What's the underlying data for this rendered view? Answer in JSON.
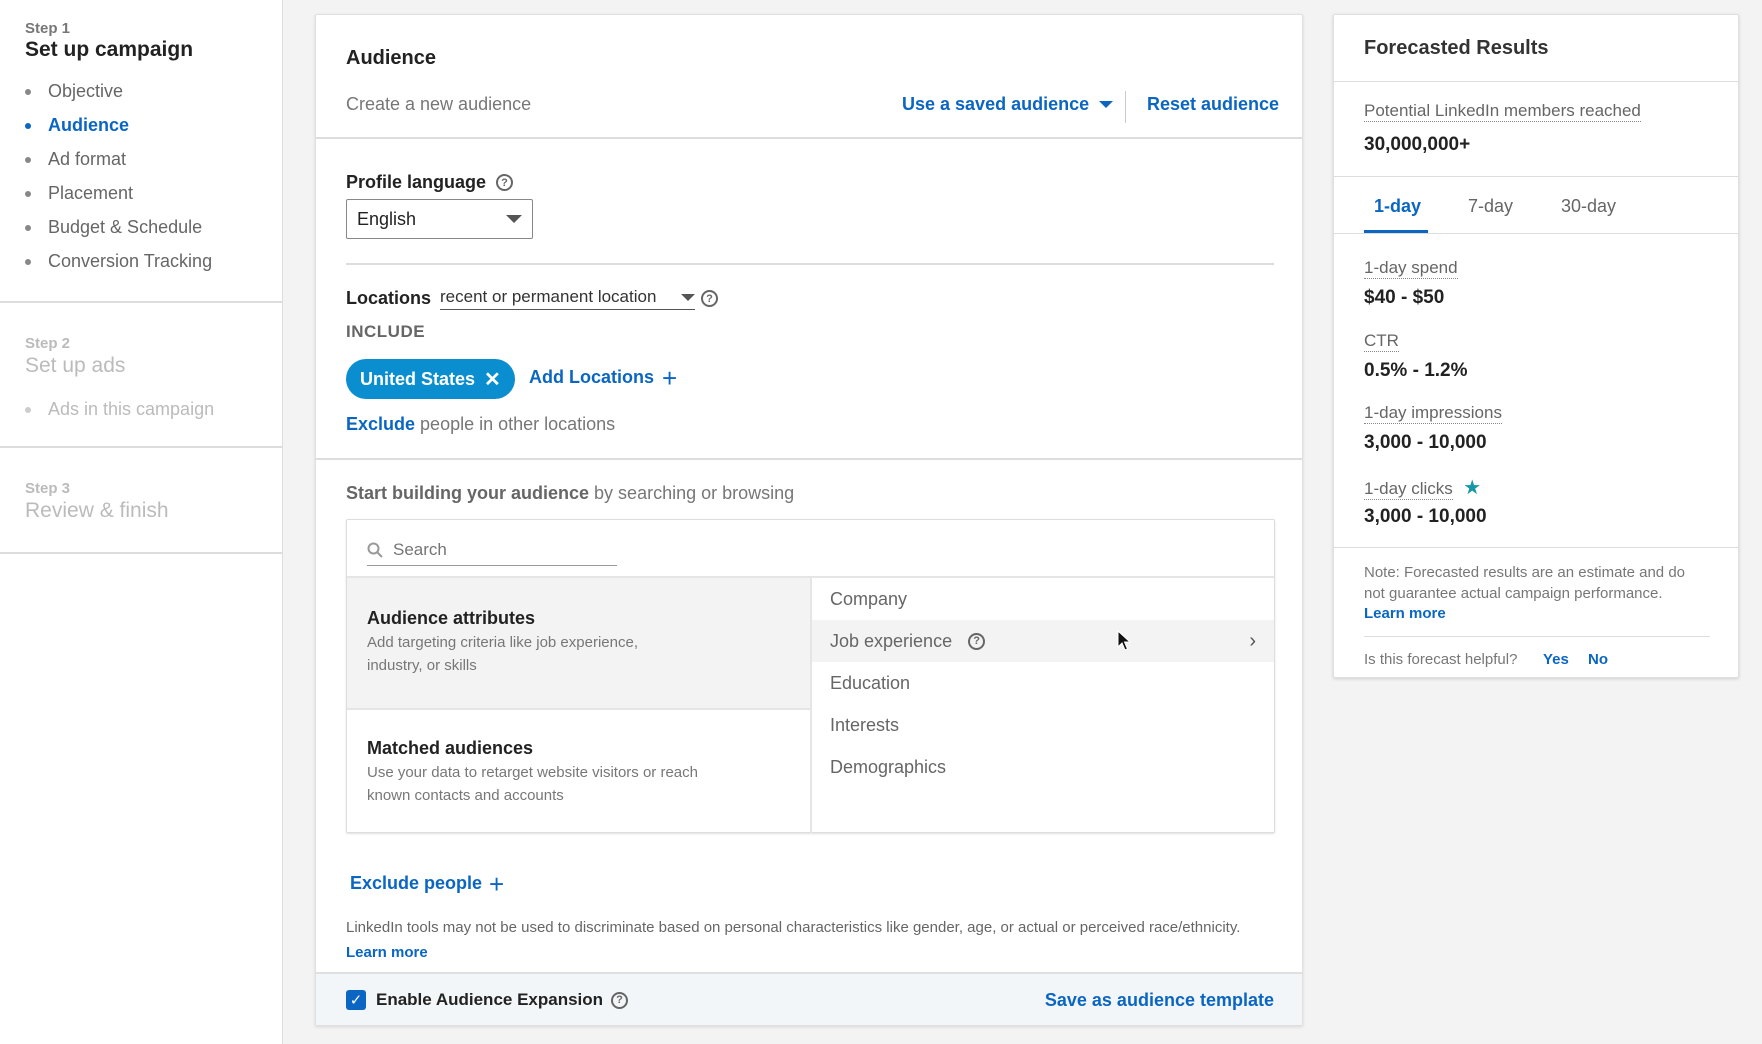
{
  "sidebar": {
    "steps": [
      {
        "step_label": "Step 1",
        "title": "Set up campaign",
        "items": [
          {
            "label": "Objective",
            "active": false
          },
          {
            "label": "Audience",
            "active": true
          },
          {
            "label": "Ad format",
            "active": false
          },
          {
            "label": "Placement",
            "active": false
          },
          {
            "label": "Budget & Schedule",
            "active": false
          },
          {
            "label": "Conversion Tracking",
            "active": false
          }
        ]
      },
      {
        "step_label": "Step 2",
        "title": "Set up ads",
        "items": [
          {
            "label": "Ads in this campaign",
            "active": false
          }
        ]
      },
      {
        "step_label": "Step 3",
        "title": "Review & finish",
        "items": []
      }
    ]
  },
  "audience": {
    "title": "Audience",
    "subtitle": "Create a new audience",
    "use_saved_label": "Use a saved audience",
    "reset_label": "Reset audience",
    "profile_language": {
      "label": "Profile language",
      "value": "English"
    },
    "locations": {
      "label": "Locations",
      "type_value": "recent or permanent location",
      "include_label": "INCLUDE",
      "included": [
        "United States"
      ],
      "add_label": "Add Locations",
      "exclude_link": "Exclude",
      "exclude_rest": "people in other locations"
    },
    "builder": {
      "heading_bold": "Start building your audience",
      "heading_rest": "by searching or browsing",
      "search_placeholder": "Search",
      "options": [
        {
          "title": "Audience attributes",
          "desc_line1": "Add targeting criteria like job experience,",
          "desc_line2": "industry, or skills"
        },
        {
          "title": "Matched audiences",
          "desc_line1": "Use your data to retarget website visitors or reach",
          "desc_line2": "known contacts and accounts"
        }
      ],
      "categories": [
        "Company",
        "Job experience",
        "Education",
        "Interests",
        "Demographics"
      ]
    },
    "exclude_people_label": "Exclude people",
    "disclaimer": "LinkedIn tools may not be used to discriminate based on personal characteristics like gender, age, or actual or perceived race/ethnicity.",
    "learn_more": "Learn more",
    "expansion_label": "Enable Audience Expansion",
    "expansion_checked": true,
    "save_template_label": "Save as audience template"
  },
  "forecast": {
    "title": "Forecasted Results",
    "reach_label": "Potential LinkedIn members reached",
    "reach_value": "30,000,000+",
    "tabs": [
      "1-day",
      "7-day",
      "30-day"
    ],
    "active_tab": "1-day",
    "metrics": [
      {
        "label": "1-day spend",
        "value": "$40 - $50"
      },
      {
        "label": "CTR",
        "value": "0.5% - 1.2%"
      },
      {
        "label": "1-day impressions",
        "value": "3,000 - 10,000"
      },
      {
        "label": "1-day clicks",
        "value": "3,000 - 10,000"
      }
    ],
    "note": "Note: Forecasted results are an estimate and do not guarantee actual campaign performance.",
    "learn_more": "Learn more",
    "helpful_q": "Is this forecast helpful?",
    "yes": "Yes",
    "no": "No"
  },
  "colors": {
    "accent": "#0a66c2",
    "pill": "#0a8ed0",
    "star": "#1597a8"
  }
}
